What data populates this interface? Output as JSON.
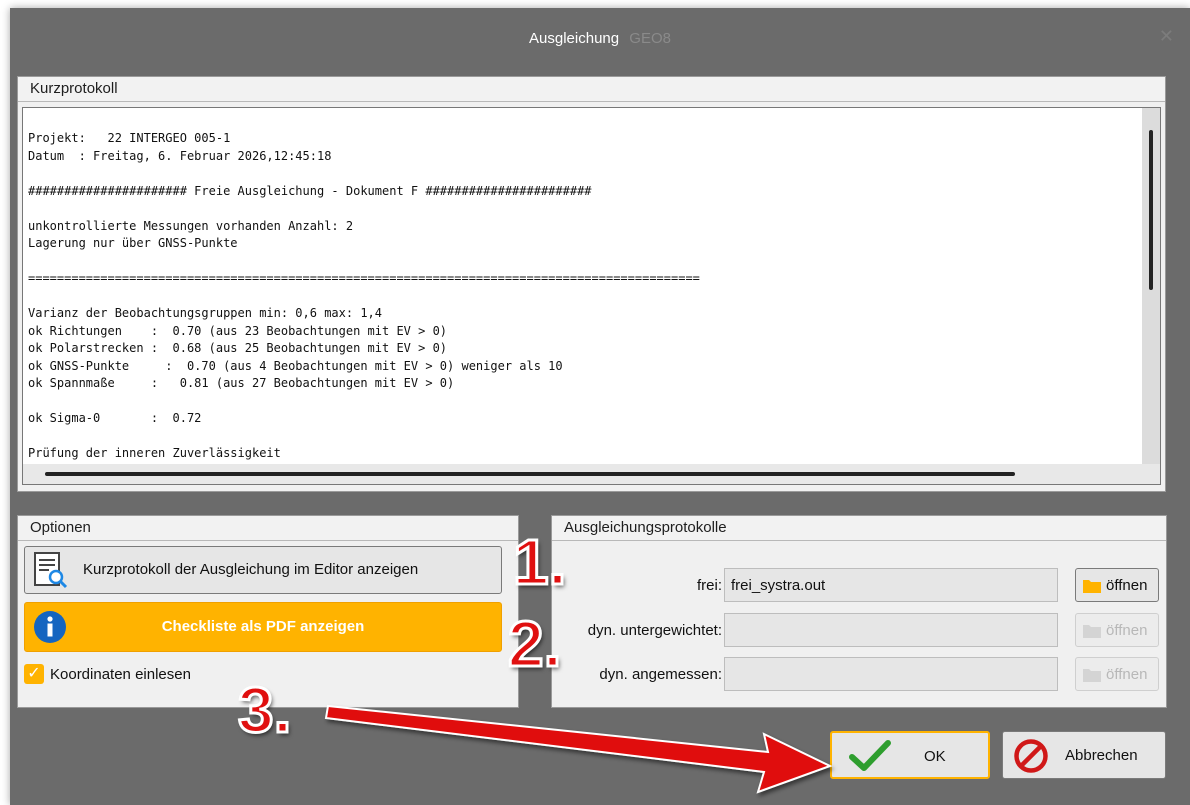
{
  "window": {
    "title": "Ausgleichung",
    "app_name": "GEO8",
    "close_glyph": "✕"
  },
  "kurzprotokoll": {
    "header": "Kurzprotokoll",
    "lines": [
      "Projekt:   22 INTERGEO 005-1",
      "Datum  : Freitag, 6. Februar 2026,12:45:18",
      "",
      "###################### Freie Ausgleichung - Dokument F #######################",
      "",
      "unkontrollierte Messungen vorhanden Anzahl: 2",
      "Lagerung nur über GNSS-Punkte",
      "",
      "=============================================================================================",
      "",
      "Varianz der Beobachtungsgruppen min: 0,6 max: 1,4",
      "ok Richtungen    :  0.70 (aus 23 Beobachtungen mit EV > 0)",
      "ok Polarstrecken :  0.68 (aus 25 Beobachtungen mit EV > 0)",
      "ok GNSS-Punkte     :  0.70 (aus 4 Beobachtungen mit EV > 0) weniger als 10",
      "ok Spannmaße     :   0.81 (aus 27 Beobachtungen mit EV > 0)",
      "",
      "ok Sigma-0       :  0.72",
      "",
      "Prüfung der inneren Zuverlässigkeit"
    ]
  },
  "optionen": {
    "header": "Optionen",
    "editor_button": "Kurzprotokoll der Ausgleichung im Editor anzeigen",
    "pdf_button": "Checkliste als PDF anzeigen",
    "checkbox_label": "Koordinaten einlesen",
    "checkbox_checked": true
  },
  "protokolle": {
    "header": "Ausgleichungsprotokolle",
    "rows": [
      {
        "label": "frei:",
        "value": "frei_systra.out",
        "button": "öffnen",
        "enabled": true
      },
      {
        "label": "dyn. untergewichtet:",
        "value": "",
        "button": "öffnen",
        "enabled": false
      },
      {
        "label": "dyn. angemessen:",
        "value": "",
        "button": "öffnen",
        "enabled": false
      }
    ]
  },
  "buttons": {
    "ok": "OK",
    "cancel": "Abbrechen"
  },
  "annotations": {
    "step1": "1.",
    "step2": "2.",
    "step3": "3."
  },
  "colors": {
    "accent": "#ffb300",
    "titlebar": "#6b6b6b",
    "annotation_red": "#e01010",
    "ok_green": "#2e9e2e",
    "info_blue": "#1565c0"
  }
}
